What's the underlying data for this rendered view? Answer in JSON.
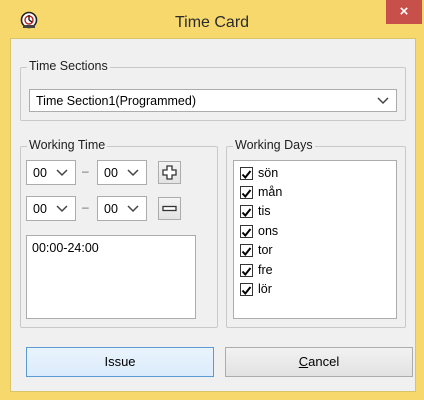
{
  "window": {
    "title": "Time Card",
    "close_glyph": "×"
  },
  "time_sections": {
    "label": "Time Sections",
    "selected": "Time Section1(Programmed)"
  },
  "working_time": {
    "label": "Working Time",
    "row1": {
      "start": "00",
      "end": "00"
    },
    "row2": {
      "start": "00",
      "end": "00"
    },
    "separator": "–",
    "add_icon": "plus-icon",
    "remove_icon": "minus-icon",
    "ranges": [
      "00:00-24:00"
    ]
  },
  "working_days": {
    "label": "Working Days",
    "days": [
      {
        "label": "sön",
        "checked": true
      },
      {
        "label": "mån",
        "checked": true
      },
      {
        "label": "tis",
        "checked": true
      },
      {
        "label": "ons",
        "checked": true
      },
      {
        "label": "tor",
        "checked": true
      },
      {
        "label": "fre",
        "checked": true
      },
      {
        "label": "lör",
        "checked": true
      }
    ]
  },
  "buttons": {
    "issue": "Issue",
    "cancel": "Cancel"
  },
  "colors": {
    "frame": "#f6d86c",
    "close": "#c7504a",
    "focus": "#5b9bd5"
  }
}
